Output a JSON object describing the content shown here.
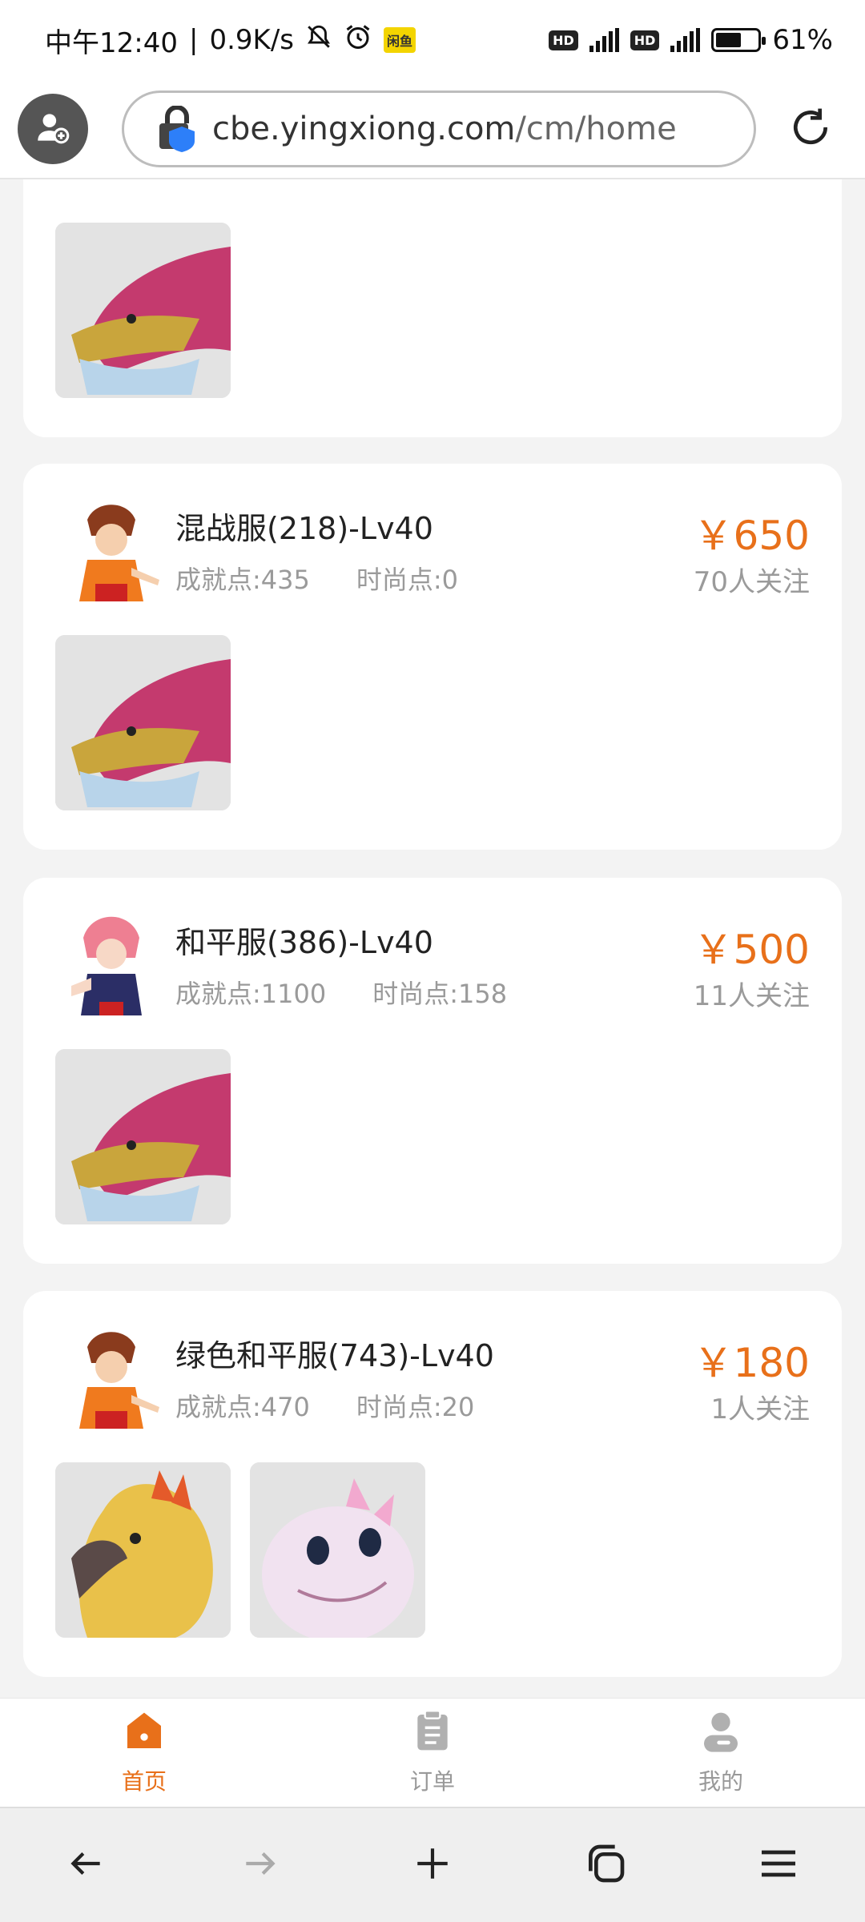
{
  "status_bar": {
    "time": "中午12:40",
    "speed": "0.9K/s",
    "app_badge": "闲鱼",
    "hd1": "HD",
    "hd2": "HD",
    "battery": "61%",
    "battery_level": 0.61
  },
  "url_bar": {
    "host": "cbe.yingxiong.com",
    "path": "/cm/home"
  },
  "listings": [
    {
      "title": "混战服(218)-Lv40",
      "achievement": "成就点:435",
      "fashion": "时尚点:0",
      "price": "￥650",
      "followers": "70人关注",
      "avatar": "red-hair-hero-avatar",
      "thumbs": [
        "dragon-mount"
      ]
    },
    {
      "title": "和平服(386)-Lv40",
      "achievement": "成就点:1100",
      "fashion": "时尚点:158",
      "price": "￥500",
      "followers": "11人关注",
      "avatar": "pink-hair-hero-avatar",
      "thumbs": [
        "dragon-mount"
      ]
    },
    {
      "title": "绿色和平服(743)-Lv40",
      "achievement": "成就点:470",
      "fashion": "时尚点:20",
      "price": "￥180",
      "followers": "1人关注",
      "avatar": "red-hair-hero-avatar",
      "thumbs": [
        "phoenix-mount",
        "pink-creature-mount"
      ]
    }
  ],
  "app_nav": {
    "home": "首页",
    "orders": "订单",
    "mine": "我的"
  },
  "colors": {
    "accent": "#e8701a",
    "muted": "#9a9a9a"
  }
}
